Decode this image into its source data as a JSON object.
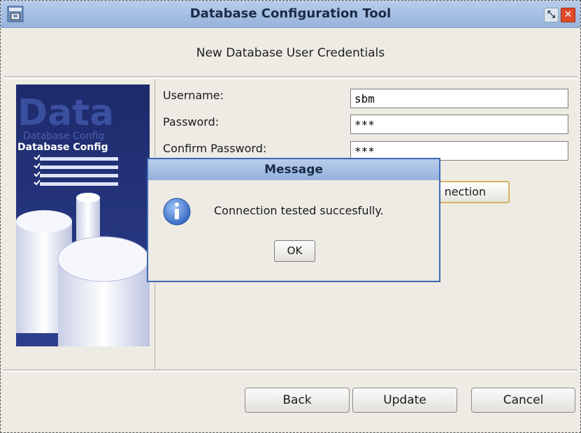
{
  "window": {
    "title": "Database Configuration Tool"
  },
  "header": {
    "title": "New Database User Credentials"
  },
  "banner": {
    "big_text": "Data",
    "caption": "Database Config",
    "caption_ghost": "Database Config"
  },
  "form": {
    "username_label": "Username:",
    "username_value": "sbm",
    "password_label": "Password:",
    "password_value": "***",
    "confirm_label": "Confirm Password:",
    "confirm_value": "***",
    "test_button_label": "nection"
  },
  "footer": {
    "back_label": "Back",
    "update_label": "Update",
    "cancel_label": "Cancel"
  },
  "dialog": {
    "title": "Message",
    "message": "Connection tested succesfully.",
    "ok_label": "OK"
  }
}
